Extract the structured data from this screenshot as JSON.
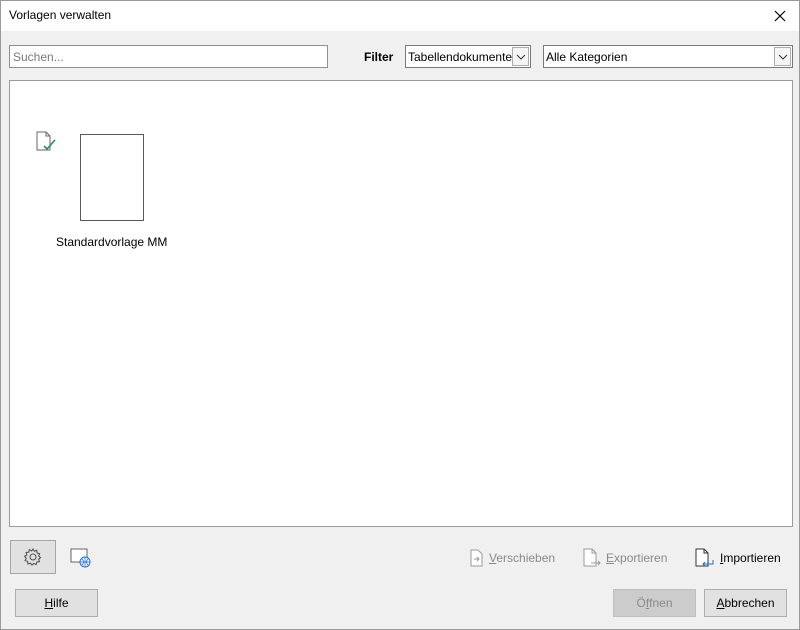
{
  "window": {
    "title": "Vorlagen verwalten"
  },
  "search": {
    "placeholder": "Suchen..."
  },
  "filter": {
    "label": "Filter",
    "document_type": "Tabellendokumente",
    "category": "Alle Kategorien"
  },
  "templates": [
    {
      "name": "Standardvorlage MM",
      "is_default": true
    }
  ],
  "actions": {
    "move_prefix": "V",
    "move_rest": "erschieben",
    "export_prefix": "E",
    "export_rest": "xportieren",
    "import_prefix": "I",
    "import_rest": "mportieren"
  },
  "buttons": {
    "help_prefix": "H",
    "help_rest": "ilfe",
    "open_pre": "Ö",
    "open_u": "f",
    "open_post": "fnen",
    "cancel_prefix": "A",
    "cancel_rest": "bbrechen"
  },
  "icons": {
    "close": "close-icon",
    "dropdown": "chevron-down-icon",
    "default_check": "default-template-icon",
    "settings": "gear-icon",
    "online": "online-templates-icon",
    "move": "move-icon",
    "export": "export-icon",
    "import": "import-icon"
  },
  "colors": {
    "check_green": "#2e8b57",
    "globe_blue": "#1f6fd0"
  }
}
